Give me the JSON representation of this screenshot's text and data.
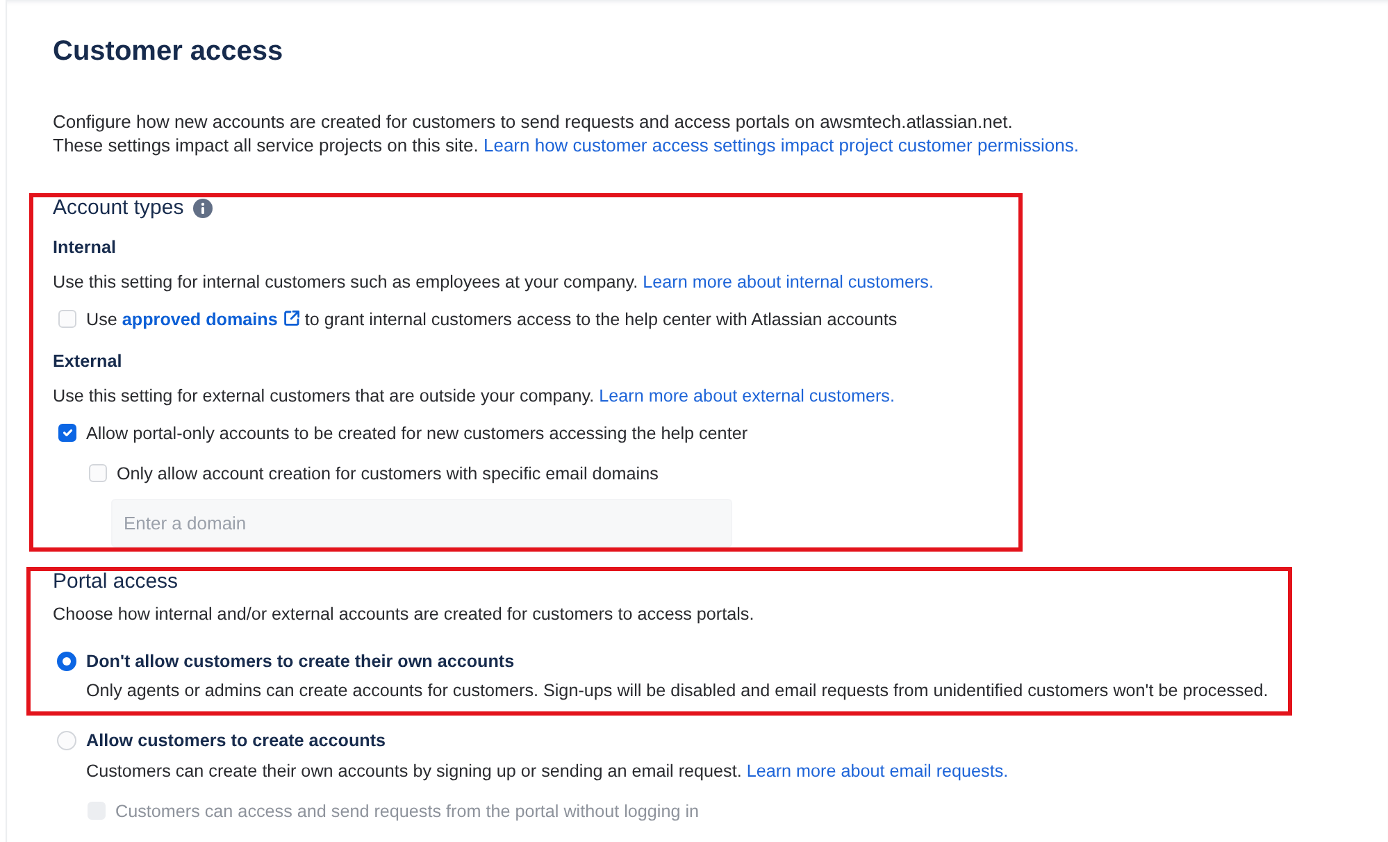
{
  "page": {
    "title": "Customer access",
    "intro": {
      "lines": [
        "Configure how new accounts are created for customers to send requests and access portals on awsmtech.atlassian.net.",
        "These settings impact all service projects on this site."
      ],
      "link": "Learn how customer access settings impact project customer permissions."
    }
  },
  "account_types": {
    "title": "Account types",
    "highlighted": true,
    "groups": [
      {
        "title": "Internal",
        "description": "Use this setting for internal customers such as employees at your company.",
        "link": "Learn more about internal customers.",
        "options": [
          {
            "kind": "checkbox",
            "label": "Use",
            "label_link": "approved domains",
            "label_after": "to grant internal customers access to the help center with Atlassian accounts",
            "checked": false,
            "disabled": false
          }
        ]
      },
      {
        "title": "External",
        "description": "Use this setting for external customers that are outside your company.",
        "link": "Learn more about external customers.",
        "options": [
          {
            "kind": "checkbox",
            "label": "Allow portal-only accounts to be created for new customers accessing the help center",
            "checked": true,
            "disabled": false,
            "children": [
              {
                "kind": "checkbox",
                "label": "Only allow account creation for customers with specific email domains",
                "checked": false,
                "disabled": false,
                "field": {
                  "placeholder": "Enter a domain"
                }
              }
            ]
          }
        ]
      }
    ]
  },
  "portal_access": {
    "title": "Portal access",
    "description": "Choose how internal and/or external accounts are created for customers to access portals.",
    "highlighted": true,
    "options": [
      {
        "kind": "radio",
        "label": "Don't allow customers to create their own accounts",
        "selected": true,
        "description": "Only agents or admins can create accounts for customers. Sign-ups will be disabled and email requests from unidentified customers won't be processed."
      },
      {
        "kind": "radio",
        "label": "Allow customers to create accounts",
        "selected": false,
        "description": "Customers can create their own accounts by signing up or sending an email request.",
        "description_link": "Learn more about email requests.",
        "children": [
          {
            "kind": "checkbox",
            "label": "Customers can access and send requests from the portal without logging in",
            "checked": false,
            "disabled": true
          }
        ]
      }
    ]
  }
}
